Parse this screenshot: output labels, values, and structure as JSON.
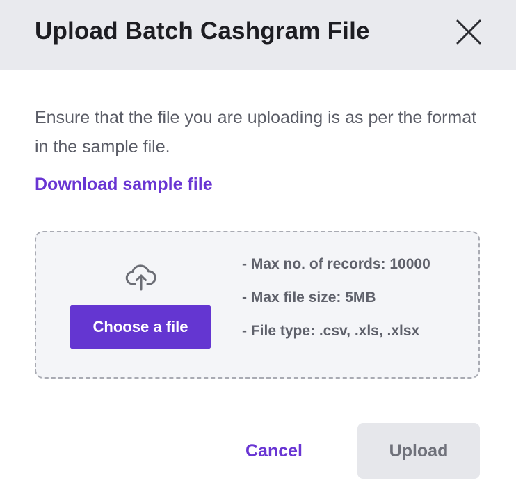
{
  "modal": {
    "title": "Upload Batch Cashgram File",
    "close_icon": "close-icon",
    "description": "Ensure that the file you are uploading is as per the format in the sample file.",
    "download_link": "Download sample file"
  },
  "dropzone": {
    "icon": "cloud-upload-icon",
    "choose_label": "Choose a file",
    "rules": [
      "- Max no. of records: 10000",
      "- Max file size: 5MB",
      "- File type: .csv, .xls, .xlsx"
    ]
  },
  "footer": {
    "cancel_label": "Cancel",
    "upload_label": "Upload",
    "upload_disabled": true
  },
  "colors": {
    "accent": "#6436d1",
    "header_bg": "#e9eaee",
    "dropzone_bg": "#f4f5f8",
    "disabled_bg": "#e6e7eb"
  }
}
